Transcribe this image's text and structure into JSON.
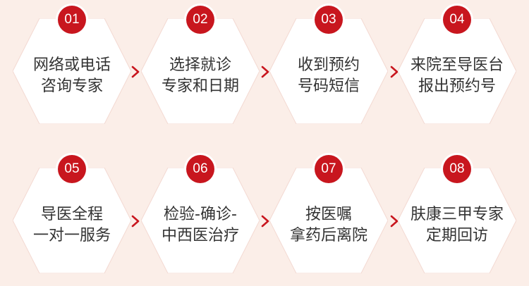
{
  "steps": [
    {
      "number": "01",
      "lines": [
        "网络或电话",
        "咨询专家"
      ]
    },
    {
      "number": "02",
      "lines": [
        "选择就诊",
        "专家和日期"
      ]
    },
    {
      "number": "03",
      "lines": [
        "收到预约",
        "号码短信"
      ]
    },
    {
      "number": "04",
      "lines": [
        "来院至导医台",
        "报出预约号"
      ]
    },
    {
      "number": "05",
      "lines": [
        "导医全程",
        "一对一服务"
      ]
    },
    {
      "number": "06",
      "lines": [
        "检验-确诊-",
        "中西医治疗"
      ]
    },
    {
      "number": "07",
      "lines": [
        "按医嘱",
        "拿药后离院"
      ]
    },
    {
      "number": "08",
      "lines": [
        "肤康三甲专家",
        "定期回访"
      ]
    }
  ],
  "colors": {
    "background": "#fbeee8",
    "badge": "#c8161e",
    "arrow": "#c8161e",
    "card": "#ffffff",
    "text": "#333333"
  },
  "icons": {
    "connector": "chevron-right-icon"
  }
}
